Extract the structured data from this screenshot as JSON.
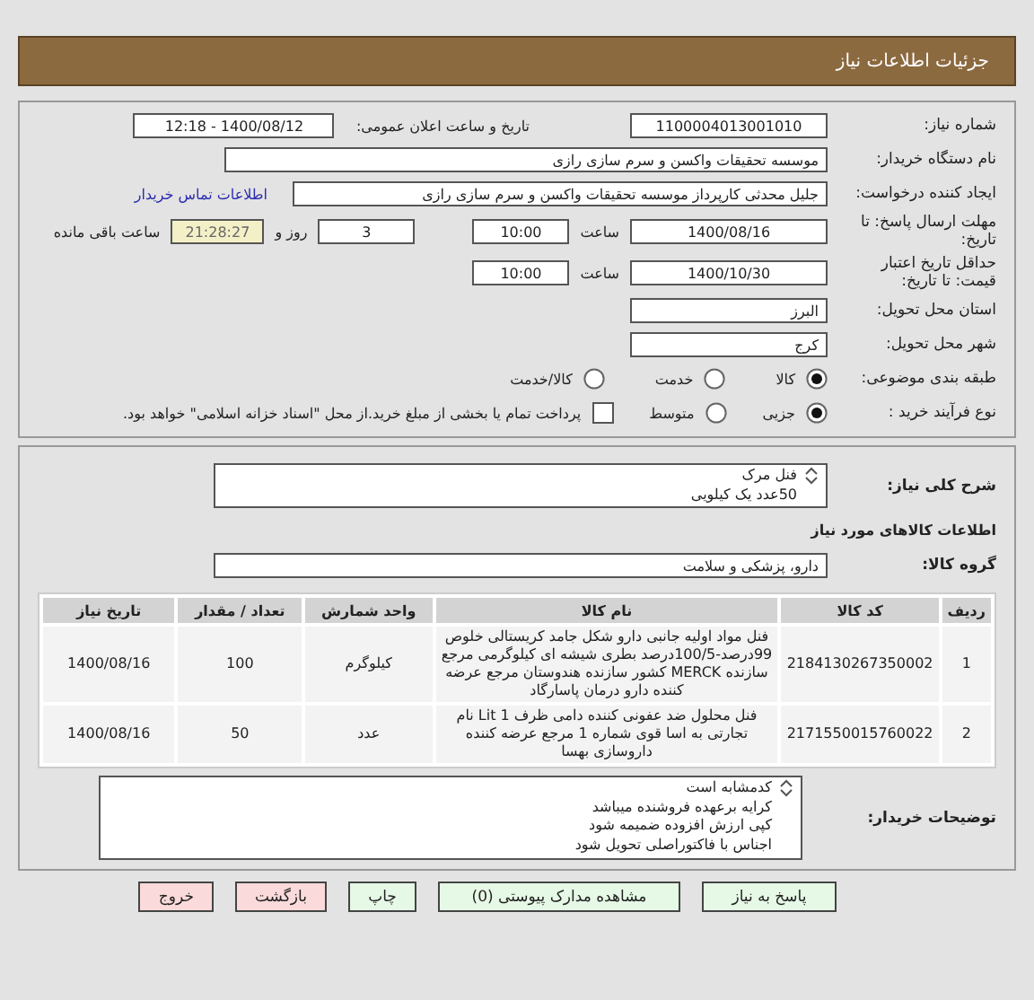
{
  "header": {
    "title": "جزئیات اطلاعات نیاز"
  },
  "info": {
    "need_number": {
      "label": "شماره نیاز:",
      "value": "1100004013001010"
    },
    "announce": {
      "label": "تاریخ و ساعت اعلان عمومی:",
      "value": "1400/08/12 - 12:18"
    },
    "buyer_org": {
      "label": "نام دستگاه خریدار:",
      "value": "موسسه تحقیقات واکسن و سرم سازی رازی"
    },
    "requester": {
      "label": "ایجاد کننده درخواست:",
      "value": "جلیل محدثی کارپرداز موسسه تحقیقات واکسن و سرم سازی رازی",
      "link": "اطلاعات تماس خریدار"
    },
    "deadline": {
      "label": "مهلت ارسال پاسخ: تا تاریخ:",
      "date": "1400/08/16",
      "time_label": "ساعت",
      "time": "10:00",
      "days": "3",
      "days_label": "روز و",
      "remaining": "21:28:27",
      "remaining_label": "ساعت باقی مانده"
    },
    "validity": {
      "label": "حداقل تاریخ اعتبار قیمت: تا تاریخ:",
      "date": "1400/10/30",
      "time_label": "ساعت",
      "time": "10:00"
    },
    "province": {
      "label": "استان محل تحویل:",
      "value": "البرز"
    },
    "city": {
      "label": "شهر محل تحویل:",
      "value": "کرج"
    },
    "category": {
      "label": "طبقه بندی موضوعی:",
      "options": [
        {
          "label": "کالا",
          "selected": true
        },
        {
          "label": "خدمت",
          "selected": false
        },
        {
          "label": "کالا/خدمت",
          "selected": false
        }
      ]
    },
    "process": {
      "label": "نوع فرآیند خرید :",
      "options": [
        {
          "label": "جزیی",
          "selected": true
        },
        {
          "label": "متوسط",
          "selected": false
        }
      ],
      "treasury": {
        "label": "پرداخت تمام یا بخشی از مبلغ خرید.از محل \"اسناد خزانه اسلامی\" خواهد بود.",
        "checked": false
      }
    }
  },
  "goods": {
    "description": {
      "label": "شرح کلی نیاز:",
      "lines": [
        "فنل مرک",
        "50عدد یک کیلویی"
      ]
    },
    "section_title": "اطلاعات کالاهای مورد نیاز",
    "group": {
      "label": "گروه کالا:",
      "value": "دارو، پزشکی و سلامت"
    },
    "table": {
      "columns": [
        "ردیف",
        "کد کالا",
        "نام کالا",
        "واحد شمارش",
        "تعداد / مقدار",
        "تاریخ نیاز"
      ],
      "rows": [
        [
          "1",
          "2184130267350002",
          "فنل مواد اولیه جانبی دارو شکل جامد کریستالی خلوص 99درصد-100/5درصد بطری شیشه ای کیلوگرمی مرجع سازنده MERCK کشور سازنده هندوستان مرجع عرضه کننده دارو درمان پاسارگاد",
          "کیلوگرم",
          "100",
          "1400/08/16"
        ],
        [
          "2",
          "2171550015760022",
          "فنل محلول ضد عفونی کننده دامی ظرف 1 Lit نام تجارتی به اسا قوی شماره 1 مرجع عرضه کننده داروسازی بهسا",
          "عدد",
          "50",
          "1400/08/16"
        ]
      ]
    },
    "notes": {
      "label": "توضیحات خریدار:",
      "lines": [
        "کدمشابه است",
        "کرایه برعهده فروشنده میباشد",
        "کپی ارزش افزوده ضمیمه شود",
        "اجناس با فاکتوراصلی تحویل شود"
      ]
    }
  },
  "buttons": [
    {
      "label": "پاسخ به نیاز",
      "kind": "action"
    },
    {
      "label": "مشاهده مدارک پیوستی (0)",
      "kind": "action"
    },
    {
      "label": "چاپ",
      "kind": "action"
    },
    {
      "label": "بازگشت",
      "kind": "exit"
    },
    {
      "label": "خروج",
      "kind": "exit"
    }
  ]
}
